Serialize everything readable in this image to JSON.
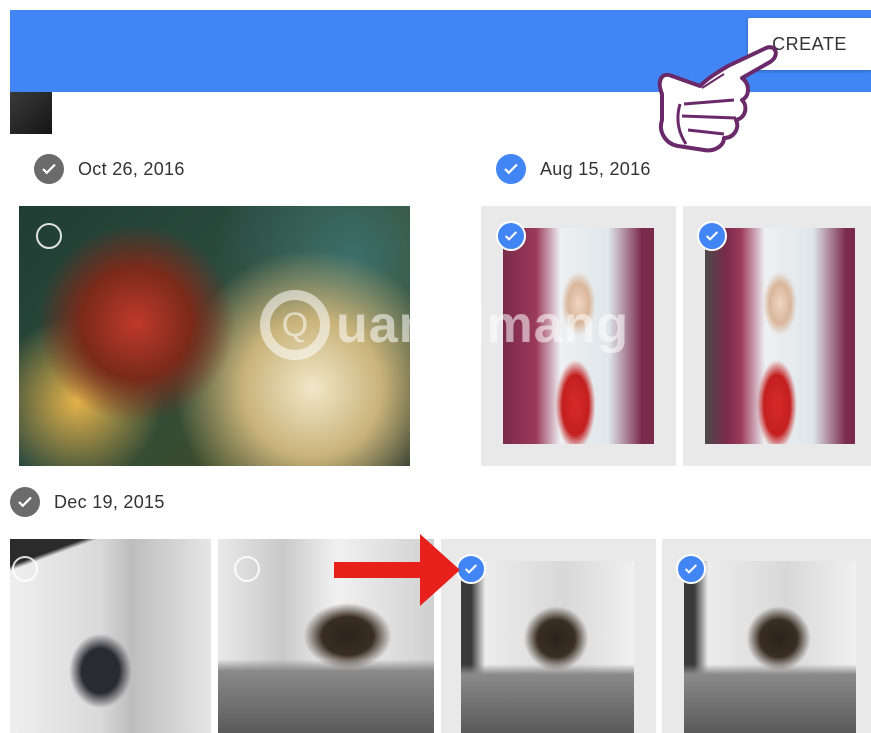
{
  "header": {
    "create_label": "CREATE",
    "color": "#4285f4"
  },
  "groups": [
    {
      "date": "Oct 26, 2016",
      "selected": true,
      "check_color": "#6b6b6b"
    },
    {
      "date": "Aug 15, 2016",
      "selected": true,
      "check_color": "#4285f4"
    },
    {
      "date": "Dec 19, 2015",
      "selected": true,
      "check_color": "#6b6b6b"
    }
  ],
  "photos": [
    {
      "group": "Oct 26, 2016",
      "selected": false,
      "subject": "collage-artwork"
    },
    {
      "group": "Aug 15, 2016",
      "selected": true,
      "subject": "child-with-toy"
    },
    {
      "group": "Aug 15, 2016",
      "selected": true,
      "subject": "child-with-toy"
    },
    {
      "group": "Dec 19, 2015",
      "selected": false,
      "subject": "dog-on-stairs"
    },
    {
      "group": "Dec 19, 2015",
      "selected": false,
      "subject": "dog-on-stairs"
    },
    {
      "group": "Dec 19, 2015",
      "selected": true,
      "subject": "dog-on-stairs"
    },
    {
      "group": "Dec 19, 2015",
      "selected": true,
      "subject": "dog-on-stairs"
    }
  ],
  "watermark": {
    "text": "uantrimang",
    "logo_letter": "Q"
  },
  "icons": {
    "check": "checkmark-icon",
    "pointer": "pointing-hand-icon",
    "arrow": "red-arrow-icon"
  },
  "accent_red": "#e8201c"
}
